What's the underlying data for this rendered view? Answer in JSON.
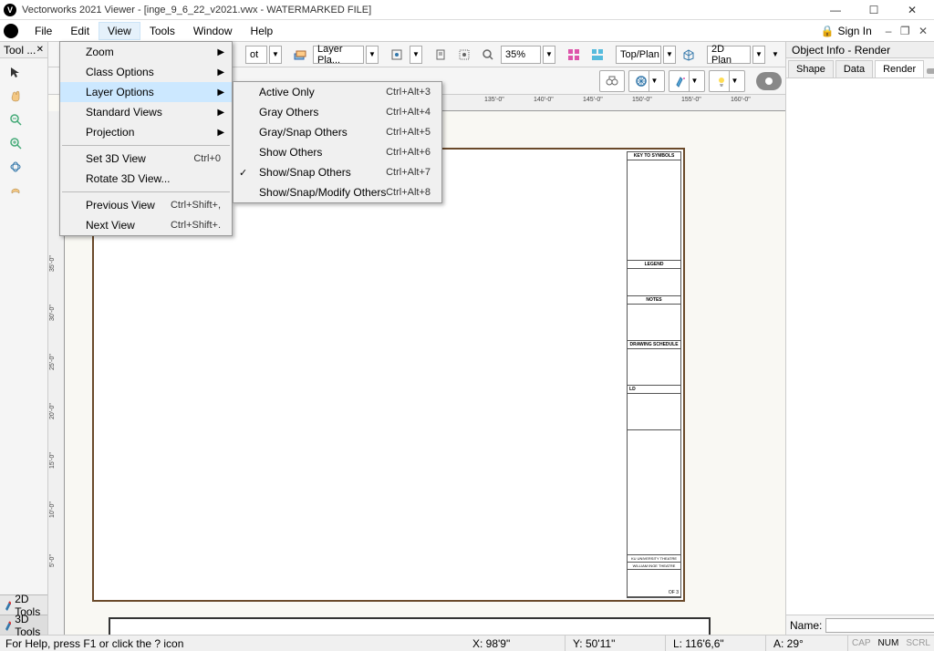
{
  "title_bar": {
    "title": "Vectorworks 2021 Viewer - [inge_9_6_22_v2021.vwx - WATERMARKED FILE]"
  },
  "menu_bar": {
    "items": [
      "File",
      "Edit",
      "View",
      "Tools",
      "Window",
      "Help"
    ],
    "sign_in": "Sign In"
  },
  "view_menu": {
    "zoom": "Zoom",
    "class_options": "Class Options",
    "layer_options": "Layer Options",
    "standard_views": "Standard Views",
    "projection": "Projection",
    "set_3d_view": "Set 3D View",
    "set_3d_view_sc": "Ctrl+0",
    "rotate_3d_view": "Rotate 3D View...",
    "previous_view": "Previous View",
    "previous_view_sc": "Ctrl+Shift+,",
    "next_view": "Next View",
    "next_view_sc": "Ctrl+Shift+."
  },
  "layer_submenu": {
    "items": [
      {
        "label": "Active Only",
        "sc": "Ctrl+Alt+3",
        "checked": false
      },
      {
        "label": "Gray Others",
        "sc": "Ctrl+Alt+4",
        "checked": false
      },
      {
        "label": "Gray/Snap Others",
        "sc": "Ctrl+Alt+5",
        "checked": false
      },
      {
        "label": "Show Others",
        "sc": "Ctrl+Alt+6",
        "checked": false
      },
      {
        "label": "Show/Snap Others",
        "sc": "Ctrl+Alt+7",
        "checked": true
      },
      {
        "label": "Show/Snap/Modify Others",
        "sc": "Ctrl+Alt+8",
        "checked": false
      }
    ]
  },
  "toolbar": {
    "layer_sel": "Layer Pla...",
    "zoom_val": "35%",
    "view_sel": "Top/Plan",
    "render_sel": "2D Plan",
    "ot_label": "ot"
  },
  "tool_panel": {
    "title": "Tool ...",
    "tab_2d": "2D Tools",
    "tab_3d": "3D Tools"
  },
  "obj_info": {
    "title": "Object Info - Render",
    "tabs": [
      "Shape",
      "Data",
      "Render"
    ],
    "name_label": "Name:"
  },
  "ruler_h": [
    "135'-0\"",
    "140'-0\"",
    "145'-0\"",
    "150'-0\"",
    "155'-0\"",
    "160'-0\""
  ],
  "ruler_v": [
    "35'-0\"",
    "30'-0\"",
    "25'-0\"",
    "20'-0\"",
    "15'-0\"",
    "10'-0\"",
    "5'-0\""
  ],
  "title_block": {
    "key_symbols": "KEY TO SYMBOLS",
    "legend": "LEGEND",
    "notes": "NOTES",
    "schedule": "DRAWING SCHEDULE",
    "ld": "LD",
    "ku": "KU UNIVERSITY THEATRE",
    "show": "WILLIAM INGE THEATRE",
    "sheet": "OF 3"
  },
  "status": {
    "help": "For Help, press F1 or click the ? icon",
    "x": "X: 98'9\"",
    "y": "Y: 50'11\"",
    "l": "L: 116'6,6\"",
    "a": "A: 29°",
    "cap": "CAP",
    "num": "NUM",
    "scrl": "SCRL"
  }
}
